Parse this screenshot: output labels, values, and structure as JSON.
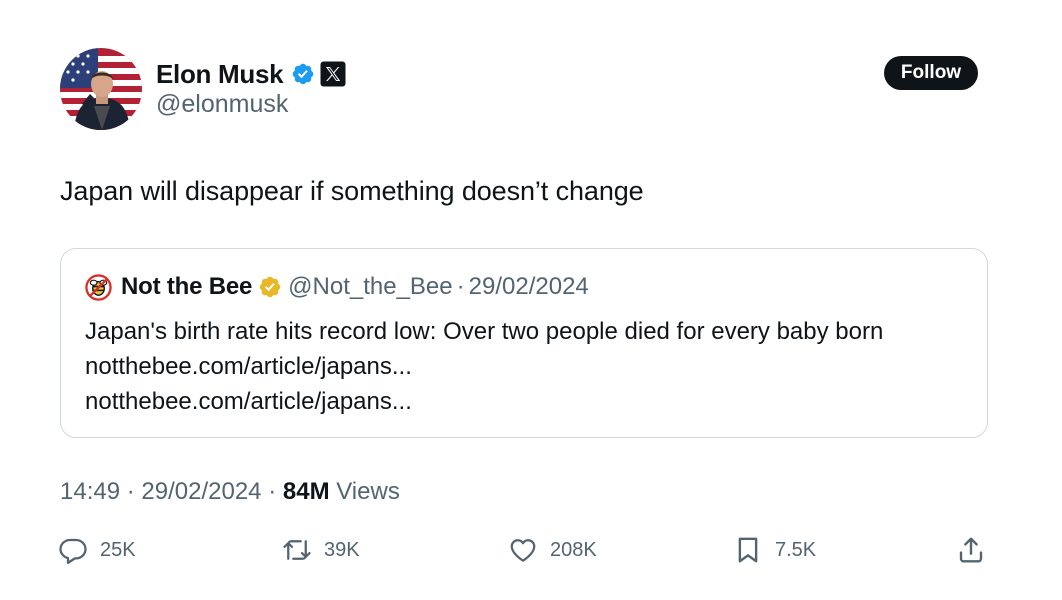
{
  "author": {
    "name": "Elon Musk",
    "handle": "@elonmusk",
    "verified": true,
    "affiliate": "X"
  },
  "follow_label": "Follow",
  "tweet_text": "Japan will disappear if something doesn’t change",
  "quote": {
    "name": "Not the Bee",
    "handle": "@Not_the_Bee",
    "separator": "·",
    "date": "29/02/2024",
    "text": "Japan's birth rate hits record low: Over two people died for every baby born",
    "links": [
      "notthebee.com/article/japans...",
      "notthebee.com/article/japans..."
    ]
  },
  "meta": {
    "time": "14:49",
    "separator": "·",
    "date": "29/02/2024",
    "views_count": "84M",
    "views_label": "Views"
  },
  "actions": {
    "reply": "25K",
    "repost": "39K",
    "like": "208K",
    "bookmark": "7.5K"
  },
  "colors": {
    "text": "#0f1419",
    "secondary": "#536471",
    "verified_blue": "#1d9bf0",
    "verified_gold": "#e8b829",
    "border": "#cfd9de"
  },
  "icons": {
    "verified": "verified-badge-icon",
    "affiliate": "x-logo-icon",
    "reply": "reply-icon",
    "repost": "repost-icon",
    "like": "heart-icon",
    "bookmark": "bookmark-icon",
    "share": "share-icon"
  }
}
